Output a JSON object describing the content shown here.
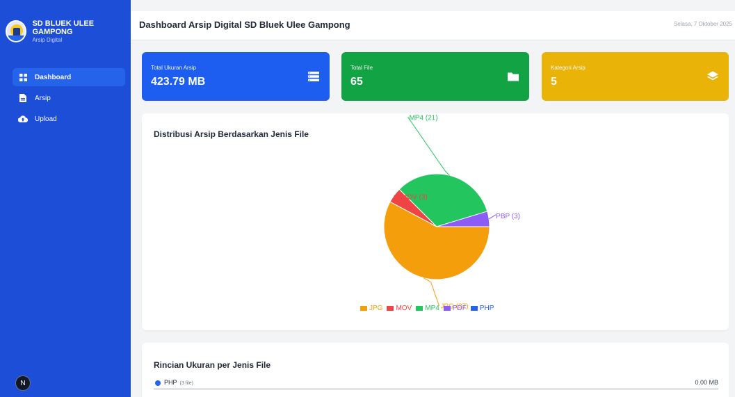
{
  "app": {
    "name": "SD BLUEK ULEE GAMPONG",
    "subtitle": "Arsip Digital"
  },
  "nav": [
    {
      "label": "Dashboard",
      "icon": "grid-icon",
      "active": true
    },
    {
      "label": "Arsip",
      "icon": "document-icon",
      "active": false
    },
    {
      "label": "Upload",
      "icon": "cloud-upload-icon",
      "active": false
    }
  ],
  "avatar": {
    "initial": "N"
  },
  "header": {
    "title": "Dashboard Arsip Digital SD Bluek Ulee Gampong",
    "date": "Selasa, 7 Oktober 2025"
  },
  "cards": [
    {
      "label": "Total Ukuran Arsip",
      "value": "423.79 MB",
      "color": "#1d5ef0",
      "icon": "list-icon"
    },
    {
      "label": "Total File",
      "value": "65",
      "color": "#12a344",
      "icon": "folder-icon"
    },
    {
      "label": "Kategori Arsip",
      "value": "5",
      "color": "#eab308",
      "icon": "layers-icon"
    }
  ],
  "chart_panel": {
    "title": "Distribusi Arsip Berdasarkan Jenis File"
  },
  "chart_data": {
    "type": "pie",
    "categories": [
      "JPG",
      "MOV",
      "MP4",
      "PDF",
      "PHP"
    ],
    "values": [
      37,
      3,
      21,
      3,
      0
    ],
    "colors": [
      "#f59e0b",
      "#ef4444",
      "#22c55e",
      "#8b5cf6",
      "#2563eb"
    ],
    "slice_labels": [
      "JPG (37)",
      "MOV (3)",
      "MP4 (21)",
      "PBP (3)",
      ""
    ],
    "legend": [
      "JPG",
      "MOV",
      "MP4",
      "PDF",
      "PHP"
    ],
    "legend_position": "bottom"
  },
  "detail_panel": {
    "title": "Rincian Ukuran per Jenis File",
    "rows": [
      {
        "type": "PHP",
        "count": "(3 file)",
        "size": "0.00 MB",
        "color": "#2563eb"
      }
    ]
  }
}
